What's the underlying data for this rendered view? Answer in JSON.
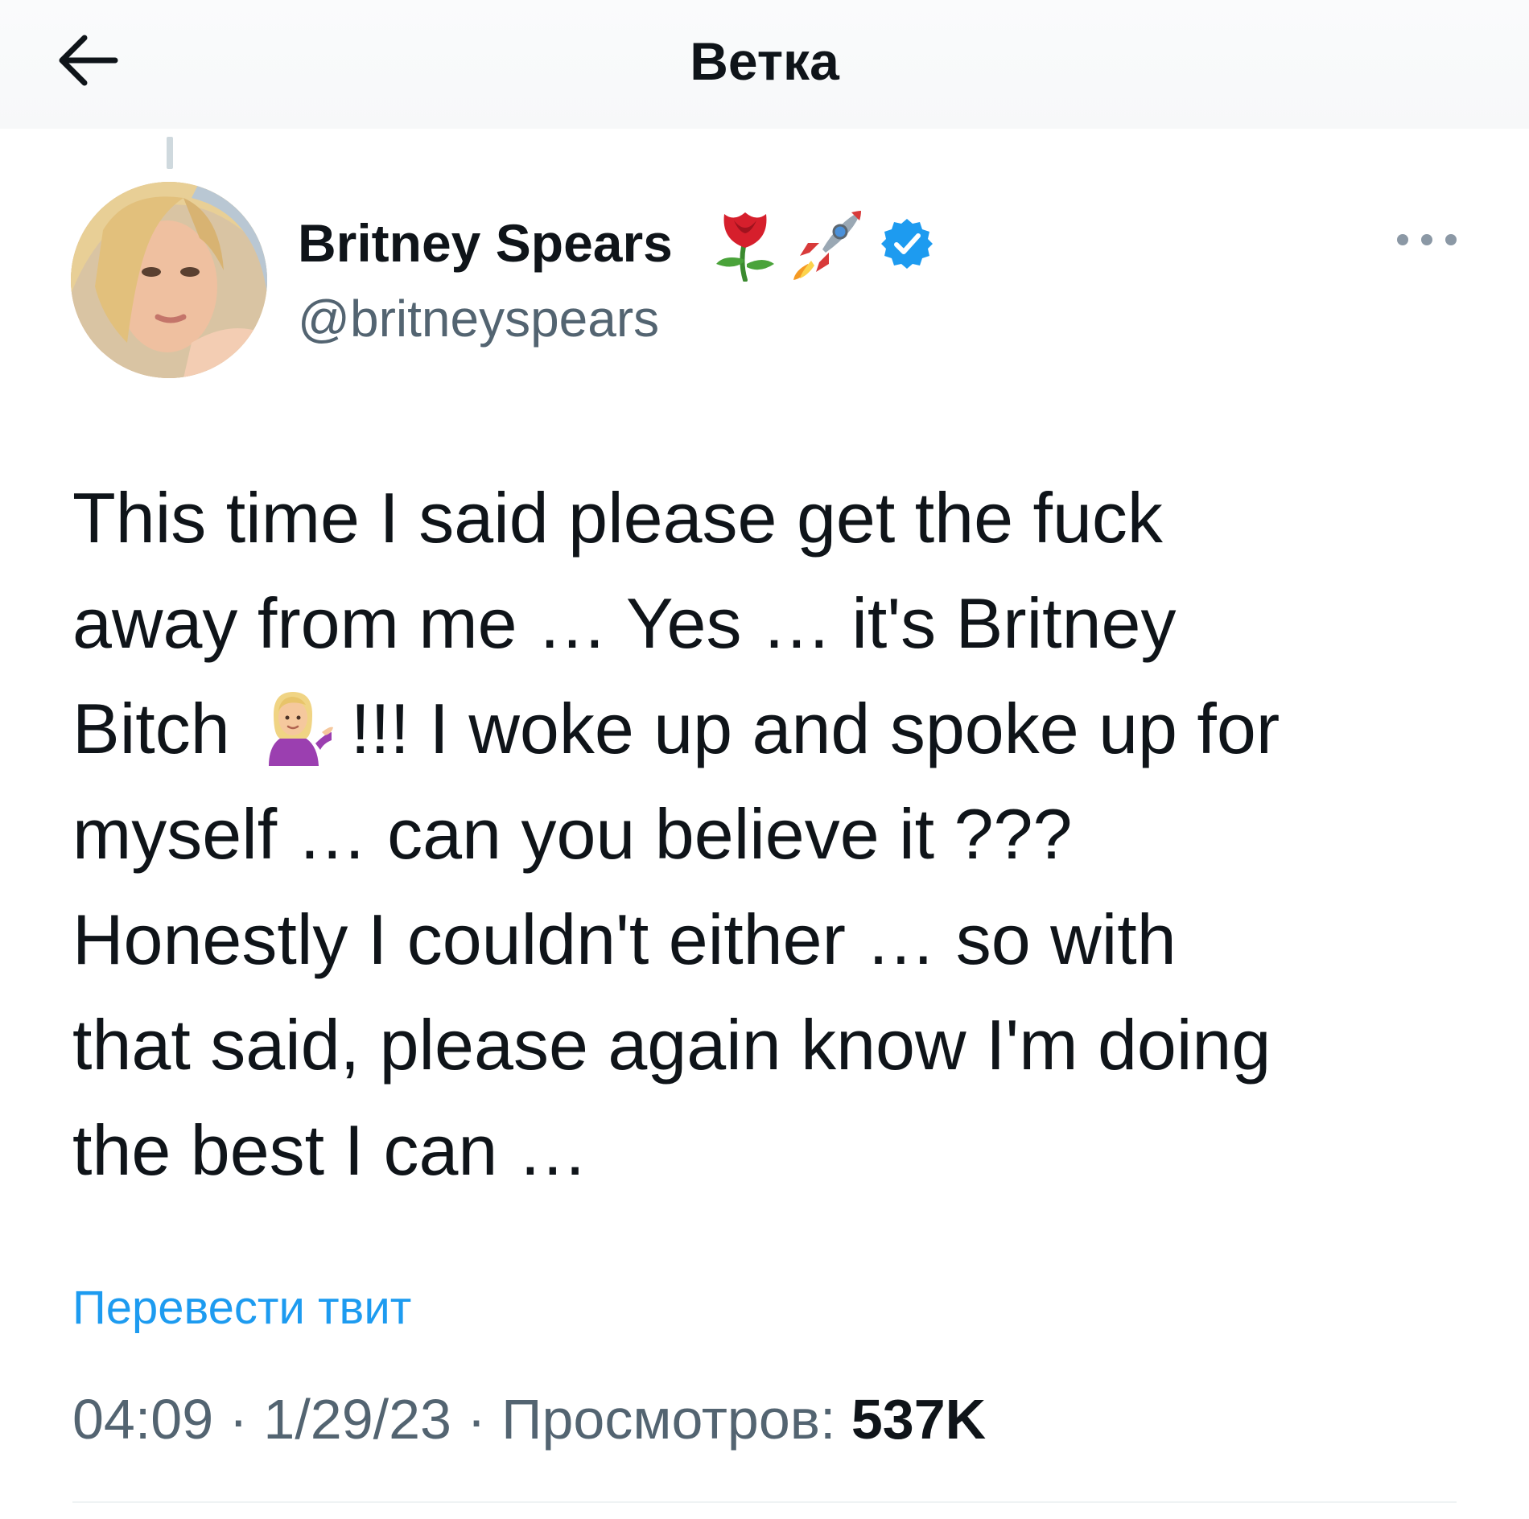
{
  "header": {
    "back_icon": "arrow-left-icon",
    "title": "Ветка"
  },
  "author": {
    "name": "Britney Spears",
    "handle": "@britneyspears",
    "name_emojis": [
      "rose-icon",
      "rocket-icon"
    ],
    "verified_icon": "verified-badge-icon",
    "verified_color": "#1d9bf0",
    "more_icon": "more-dots-icon"
  },
  "tweet": {
    "lines": [
      "This time I said please get the fuck",
      "away from me … Yes … it's Britney",
      "Bitch",
      "!!! I woke up and spoke up for",
      "myself  … can you believe it ???",
      "Honestly I couldn't either … so with",
      "that said, please again know I'm doing",
      "the best I can …"
    ],
    "inline_emoji": "woman-tipping-hand-icon"
  },
  "translate_label": "Перевести твит",
  "meta": {
    "time": "04:09",
    "separator": " · ",
    "date": "1/29/23",
    "views_label": "Просмотров: ",
    "views_count": "537K"
  },
  "colors": {
    "link": "#1d9bf0",
    "secondary_text": "#536471",
    "primary_text": "#0f1419"
  }
}
